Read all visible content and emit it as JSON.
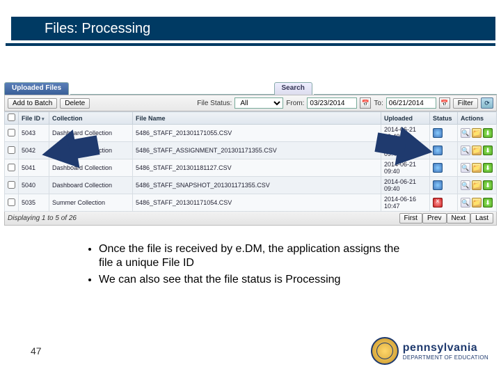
{
  "title": "Files: Processing",
  "tabs": {
    "uploaded": "Uploaded Files",
    "search": "Search"
  },
  "toolbar": {
    "add": "Add to Batch",
    "delete": "Delete",
    "status_label": "File Status:",
    "status_value": "All",
    "from_label": "From:",
    "from_value": "03/23/2014",
    "to_label": "To:",
    "to_value": "06/21/2014",
    "filter": "Filter"
  },
  "headers": {
    "file_id": "File ID",
    "collection": "Collection",
    "file_name": "File Name",
    "uploaded": "Uploaded",
    "status": "Status",
    "actions": "Actions"
  },
  "rows": [
    {
      "id": "5043",
      "collection": "Dashboard Collection",
      "file": "5486_STAFF_201301171055.CSV",
      "uploaded": "2014-06-21 09:40"
    },
    {
      "id": "5042",
      "collection": "Dashboard Collection",
      "file": "5486_STAFF_ASSIGNMENT_201301171355.CSV",
      "uploaded": "2014-06-21 09:40"
    },
    {
      "id": "5041",
      "collection": "Dashboard Collection",
      "file": "5486_STAFF_201301181127.CSV",
      "uploaded": "2014-06-21 09:40"
    },
    {
      "id": "5040",
      "collection": "Dashboard Collection",
      "file": "5486_STAFF_SNAPSHOT_201301171355.CSV",
      "uploaded": "2014-06-21 09:40"
    },
    {
      "id": "5035",
      "collection": "Summer Collection",
      "file": "5486_STAFF_201301171054.CSV",
      "uploaded": "2014-06-16 10:47"
    }
  ],
  "pager": {
    "info": "Displaying 1 to 5 of 26",
    "first": "First",
    "prev": "Prev",
    "next": "Next",
    "last": "Last"
  },
  "bullets": [
    "Once the file is received by e.DM, the application assigns the file a unique File ID",
    "We can also see that the file status is Processing"
  ],
  "slide_num": "47",
  "logo": {
    "line1": "pennsylvania",
    "line2": "DEPARTMENT OF EDUCATION"
  }
}
